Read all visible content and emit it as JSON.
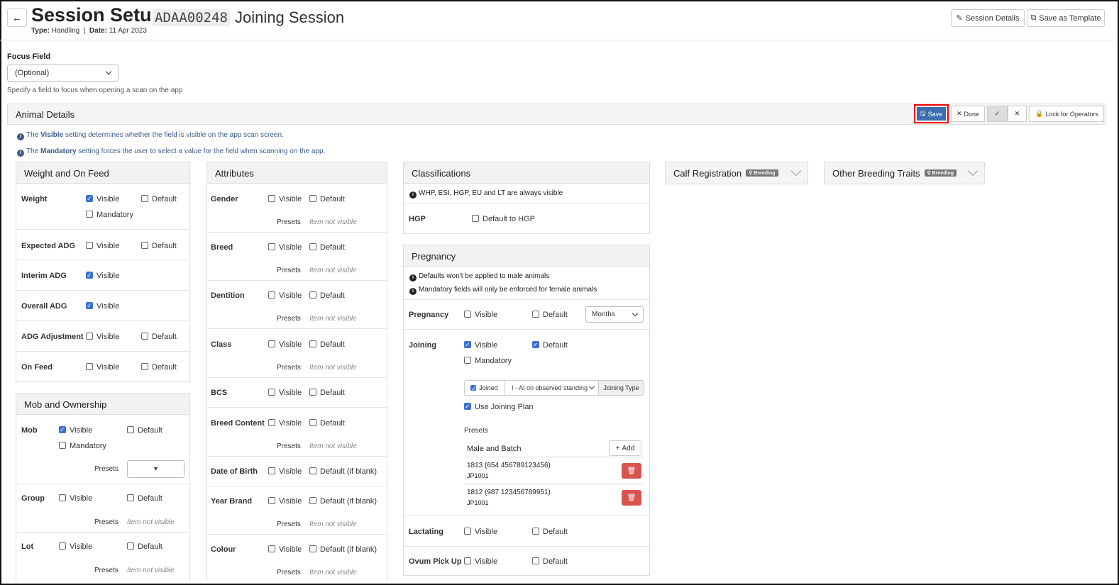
{
  "header": {
    "title": "Session Setup",
    "code": "ADAA00248",
    "name": "Joining Session",
    "type_label": "Type:",
    "type_value": "Handling",
    "date_label": "Date:",
    "date_value": "11 Apr 2023",
    "session_details_btn": "Session Details",
    "save_template_btn": "Save as Template"
  },
  "focus": {
    "label": "Focus Field",
    "selected": "(Optional)",
    "help": "Specify a field to focus when opening a scan on the app"
  },
  "animal_details": {
    "title": "Animal Details",
    "save": "Save",
    "done": "Done",
    "lock": "Lock for Operators",
    "info1_pre": "The ",
    "info1_bold": "Visible",
    "info1_post": " setting determines whether the field is visible on the app scan screen.",
    "info2_pre": "The ",
    "info2_bold": "Mandatory",
    "info2_post": " setting forces the user to select a value for the field when scanning on the app."
  },
  "common": {
    "visible": "Visible",
    "default": "Default",
    "mandatory": "Mandatory",
    "presets": "Presets",
    "item_not_visible": "Item not visible",
    "default_if_blank": "Default (if blank)"
  },
  "weight_panel": {
    "title": "Weight and On Feed",
    "rows": [
      "Weight",
      "Expected ADG",
      "Interim ADG",
      "Overall ADG",
      "ADG Adjustment",
      "On Feed"
    ]
  },
  "mob_panel": {
    "title": "Mob and Ownership",
    "rows": [
      "Mob",
      "Group",
      "Lot"
    ]
  },
  "attributes_panel": {
    "title": "Attributes",
    "rows": [
      "Gender",
      "Breed",
      "Dentition",
      "Class",
      "BCS",
      "Breed Content",
      "Date of Birth",
      "Year Brand",
      "Colour"
    ]
  },
  "classifications_panel": {
    "title": "Classifications",
    "note": "WHP, ESI, HGP, EU and LT are always visible",
    "hgp_label": "HGP",
    "hgp_option": "Default to HGP"
  },
  "pregnancy_panel": {
    "title": "Pregnancy",
    "note1": "Defaults won't be applied to male animals",
    "note2": "Mandatory fields will only be enforced for female animals",
    "pregnancy_label": "Pregnancy",
    "months": "Months",
    "joining_label": "Joining",
    "joined": "Joined",
    "joining_method": "I - AI on observed standing",
    "joining_type": "Joining Type",
    "use_joining_plan": "Use Joining Plan",
    "presets": "Presets",
    "male_batch_header": "Male and Batch",
    "add": "Add",
    "presets_list": [
      {
        "title": "1813 (654 456789123456)",
        "sub": "JP1001"
      },
      {
        "title": "1812 (987 123456789951)",
        "sub": "JP1001"
      }
    ],
    "lactating_label": "Lactating",
    "ovum_label": "Ovum Pick Up"
  },
  "calf_registration": {
    "title": "Calf Registration",
    "badge": "Breeding"
  },
  "other_breeding": {
    "title": "Other Breeding Traits",
    "badge": "Breeding"
  }
}
